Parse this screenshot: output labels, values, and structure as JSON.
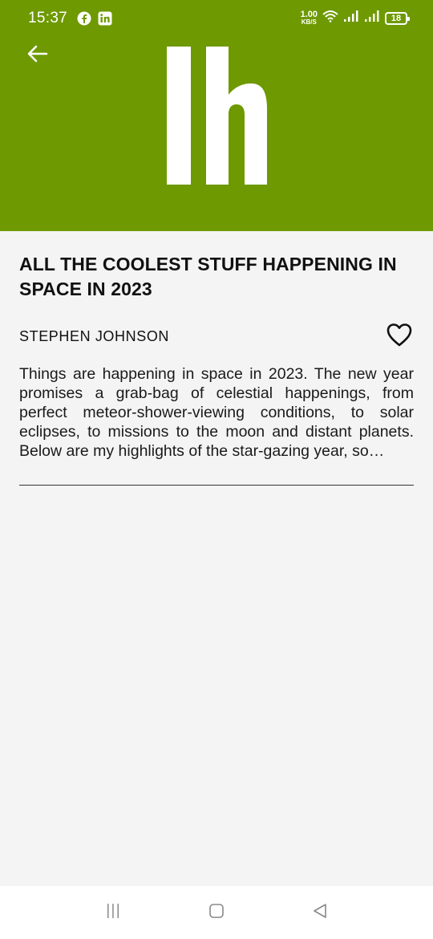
{
  "status_bar": {
    "time": "15:37",
    "speed_value": "1.00",
    "speed_unit": "KB/S",
    "battery": "18",
    "left_icons": [
      "facebook-icon",
      "linkedin-icon"
    ],
    "right_icons": [
      "wifi-icon",
      "signal-icon",
      "signal-icon"
    ]
  },
  "header": {
    "background": "#6e9900",
    "logo_text": "lh"
  },
  "article": {
    "title": "ALL THE COOLEST STUFF HAPPENING IN SPACE IN 2023",
    "author": "STEPHEN JOHNSON",
    "summary": "Things are happening in space in 2023. The new year promises a grab-bag of celestial happenings, from perfect meteor-shower-viewing conditions, to solar eclipses, to missions to the moon and distant planets. Below are my highlights of the star-gazing year, so…"
  },
  "nav": {
    "icons": [
      "recents-icon",
      "home-icon",
      "back-triangle-icon"
    ]
  }
}
